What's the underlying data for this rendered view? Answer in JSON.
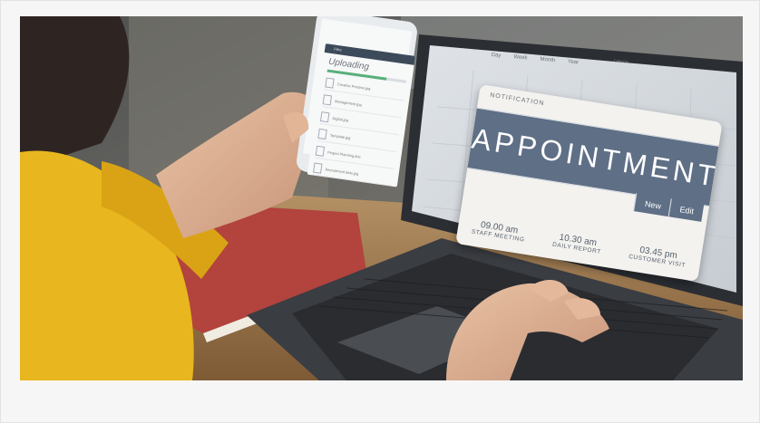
{
  "photo": {
    "alt": "Person using a smartphone while typing on a laptop showing a calendar appointment notification"
  },
  "laptop_screen": {
    "calendar_tabs": [
      "Day",
      "Week",
      "Month",
      "Year"
    ],
    "calendar_title": "Calendar"
  },
  "notification_card": {
    "header": "NOTIFICATION",
    "title": "APPOINTMENT",
    "actions": [
      "New",
      "Edit"
    ],
    "slots": [
      {
        "time": "09.00 am",
        "desc": "STAFF MEETING"
      },
      {
        "time": "10.30 am",
        "desc": "DAILY REPORT"
      },
      {
        "time": "03.45 pm",
        "desc": "CUSTOMER VISIT"
      }
    ]
  },
  "phone_screen": {
    "header": "Files",
    "title": "Uploading",
    "progress": 0.75,
    "files": [
      "Creative Process.jpg",
      "Management.jpg",
      "Digital.jpg",
      "Template.jpg",
      "Project Planning.doc",
      "Recruitment data.jpg"
    ]
  },
  "colors": {
    "card_band": "#5e6f86",
    "sweater": "#e8b61e",
    "notebook": "#b2433d",
    "page_bg": "#f6f6f6"
  }
}
